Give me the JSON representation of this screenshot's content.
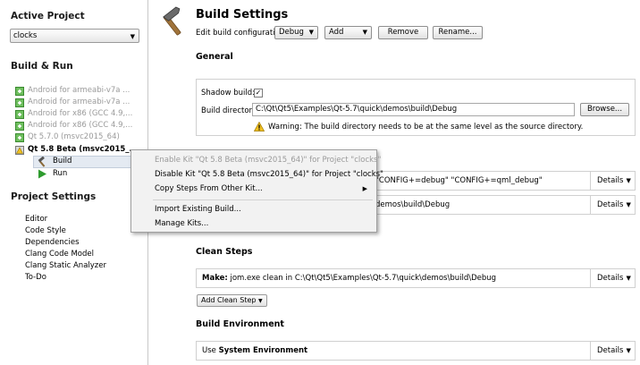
{
  "sidebar": {
    "active_project_heading": "Active Project",
    "project_select_value": "clocks",
    "build_run_heading": "Build & Run",
    "kits": [
      {
        "label": "Android for armeabi-v7a ...",
        "active": false
      },
      {
        "label": "Android for armeabi-v7a ...",
        "active": false
      },
      {
        "label": "Android for x86 (GCC 4.9,...",
        "active": false
      },
      {
        "label": "Android for x86 (GCC 4.9,...",
        "active": false
      },
      {
        "label": "Qt 5.7.0 (msvc2015_64)",
        "active": false
      },
      {
        "label": "Qt 5.8 Beta (msvc2015_...",
        "active": true
      }
    ],
    "build_label": "Build",
    "run_label": "Run",
    "project_settings_heading": "Project Settings",
    "settings_items": [
      "Editor",
      "Code Style",
      "Dependencies",
      "Clang Code Model",
      "Clang Static Analyzer",
      "To-Do"
    ]
  },
  "header": {
    "title": "Build Settings",
    "edit_config_label": "Edit build configuration:",
    "config_value": "Debug",
    "add_label": "Add",
    "remove_label": "Remove",
    "rename_label": "Rename..."
  },
  "general": {
    "heading": "General",
    "shadow_build_label": "Shadow build:",
    "shadow_build_checked": "✓",
    "build_dir_label": "Build directory:",
    "build_dir_value": "C:\\Qt\\Qt5\\Examples\\Qt-5.7\\quick\\demos\\build\\Debug",
    "browse_label": "Browse...",
    "warning_text": "Warning: The build directory needs to be at the same level as the source directory."
  },
  "build_steps": {
    "qmake_tail": "\"CONFIG+=debug\" \"CONFIG+=qml_debug\"",
    "make_tail": "demos\\build\\Debug",
    "details_label": "Details"
  },
  "clean_steps": {
    "heading": "Clean Steps",
    "make_prefix": "Make:",
    "make_rest": " jom.exe clean in C:\\Qt\\Qt5\\Examples\\Qt-5.7\\quick\\demos\\build\\Debug",
    "details_label": "Details",
    "add_clean_step_label": "Add Clean Step"
  },
  "build_env": {
    "heading": "Build Environment",
    "use_prefix": "Use ",
    "use_bold": "System Environment",
    "details_label": "Details"
  },
  "context_menu": {
    "enable_kit": "Enable Kit \"Qt 5.8 Beta (msvc2015_64)\" for Project \"clocks\"",
    "disable_kit": "Disable Kit \"Qt 5.8 Beta (msvc2015_64)\" for Project \"clocks\"",
    "copy_steps": "Copy Steps From Other Kit...",
    "import_build": "Import Existing Build...",
    "manage_kits": "Manage Kits..."
  },
  "colors": {
    "kit_ok_green": "#3aa030",
    "run_green": "#2e9b2e",
    "warning_yellow": "#f0c020",
    "selection_blue": "#e4eaf2"
  }
}
